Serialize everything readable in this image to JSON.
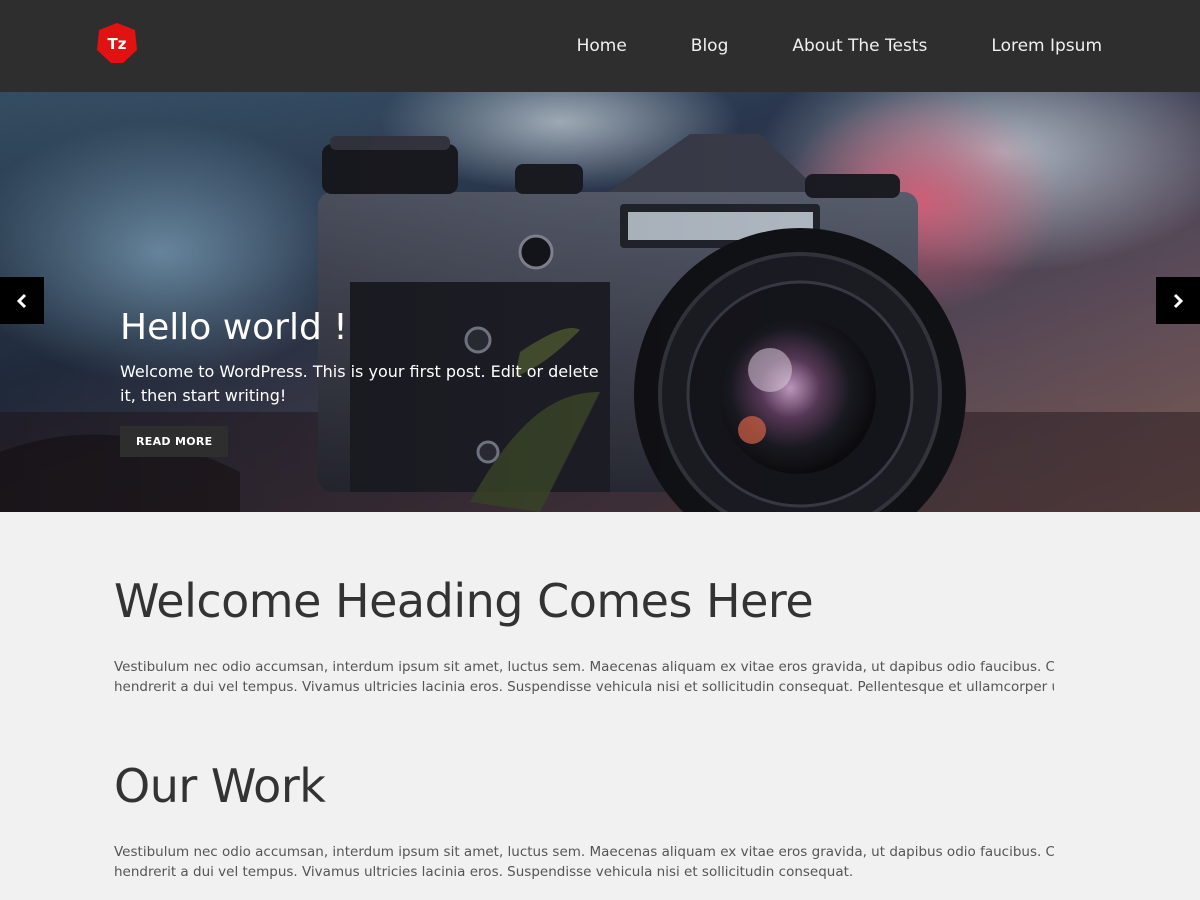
{
  "header": {
    "logo_text": "Tz",
    "logo_color": "#e11212",
    "nav": [
      {
        "label": "Home"
      },
      {
        "label": "Blog"
      },
      {
        "label": "About The Tests"
      },
      {
        "label": "Lorem Ipsum"
      }
    ]
  },
  "slider": {
    "prev_icon": "chevron-left-icon",
    "next_icon": "chevron-right-icon",
    "slide": {
      "title": "Hello world !",
      "excerpt": "Welcome to WordPress. This is your first post. Edit or delete it, then start writing!",
      "button_label": "READ MORE"
    }
  },
  "welcome": {
    "heading": "Welcome Heading Comes Here",
    "body_line1": "Vestibulum nec odio accumsan, interdum ipsum sit amet, luctus sem. Maecenas aliquam ex vitae eros gravida, ut dapibus odio faucibus. Curabitur",
    "body_line2": "hendrerit a dui vel tempus. Vivamus ultricies lacinia eros. Suspendisse vehicula nisi et sollicitudin consequat. Pellentesque et ullamcorper urna, vel"
  },
  "work": {
    "heading": "Our Work",
    "body_line1": "Vestibulum nec odio accumsan, interdum ipsum sit amet, luctus sem. Maecenas aliquam ex vitae eros gravida, ut dapibus odio faucibus. Curabitur",
    "body_line2": "hendrerit a dui vel tempus. Vivamus ultricies lacinia eros. Suspendisse vehicula nisi et sollicitudin consequat."
  },
  "colors": {
    "header_bg": "#2e2e2e",
    "page_bg": "#f1f1f1",
    "accent": "#e11212"
  }
}
